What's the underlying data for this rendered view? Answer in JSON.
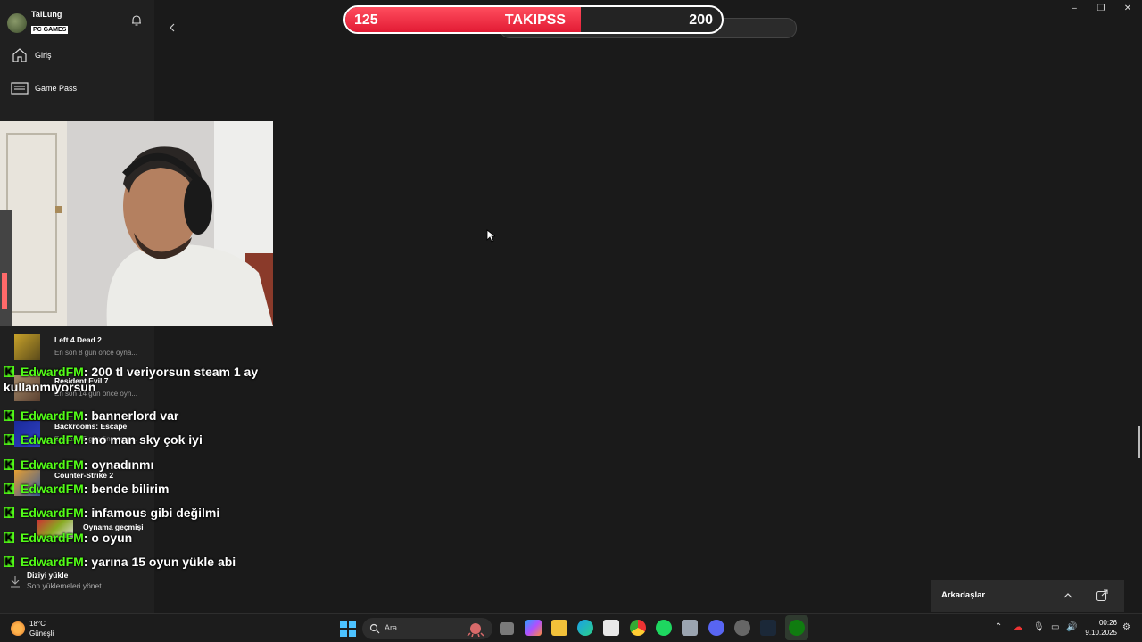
{
  "sidebar": {
    "gamertag": "TalLung",
    "badge": "PC GAMES",
    "nav": [
      {
        "label": "Giriş"
      },
      {
        "label": "Game Pass"
      }
    ],
    "recent_games": [
      {
        "title": "Left 4 Dead 2",
        "sub": "En son 8 gün önce oyna..."
      },
      {
        "title": "Resident Evil 7",
        "sub": "En son 14 gün önce oyn..."
      },
      {
        "title": "Backrooms: Escape",
        "sub": "En son 15 gün önce oyn..."
      },
      {
        "title": "Counter-Strike 2",
        "sub": ""
      }
    ],
    "history_label": "Oynama geçmişi",
    "download": {
      "title": "Diziyi yükle",
      "sub": "Son yüklemeleri yönet"
    }
  },
  "goal": {
    "current": "125",
    "title": "TAKIPSS",
    "max": "200",
    "progress_fraction": 0.625,
    "fill_color": "#e21b34"
  },
  "chat": {
    "messages": [
      {
        "user": "EdwardFM",
        "text": ": 200 tl veriyorsun steam 1 ay kullanmıyorsun"
      },
      {
        "user": "EdwardFM",
        "text": ": bannerlord var"
      },
      {
        "user": "EdwardFM",
        "text": ": no man sky çok iyi"
      },
      {
        "user": "EdwardFM",
        "text": ": oynadınmı"
      },
      {
        "user": "EdwardFM",
        "text": ": bende bilirim"
      },
      {
        "user": "EdwardFM",
        "text": ": infamous gibi değilmi"
      },
      {
        "user": "EdwardFM",
        "text": ": o oyun"
      },
      {
        "user": "EdwardFM",
        "text": ": yarına 15 oyun yükle abi"
      }
    ],
    "user_color": "#53fc18"
  },
  "friends": {
    "label": "Arkadaşlar"
  },
  "taskbar": {
    "weather_temp": "18°C",
    "weather_cond": "Güneşli",
    "search_label": "Ara",
    "time": "00:26",
    "date": "9.10.2025"
  }
}
